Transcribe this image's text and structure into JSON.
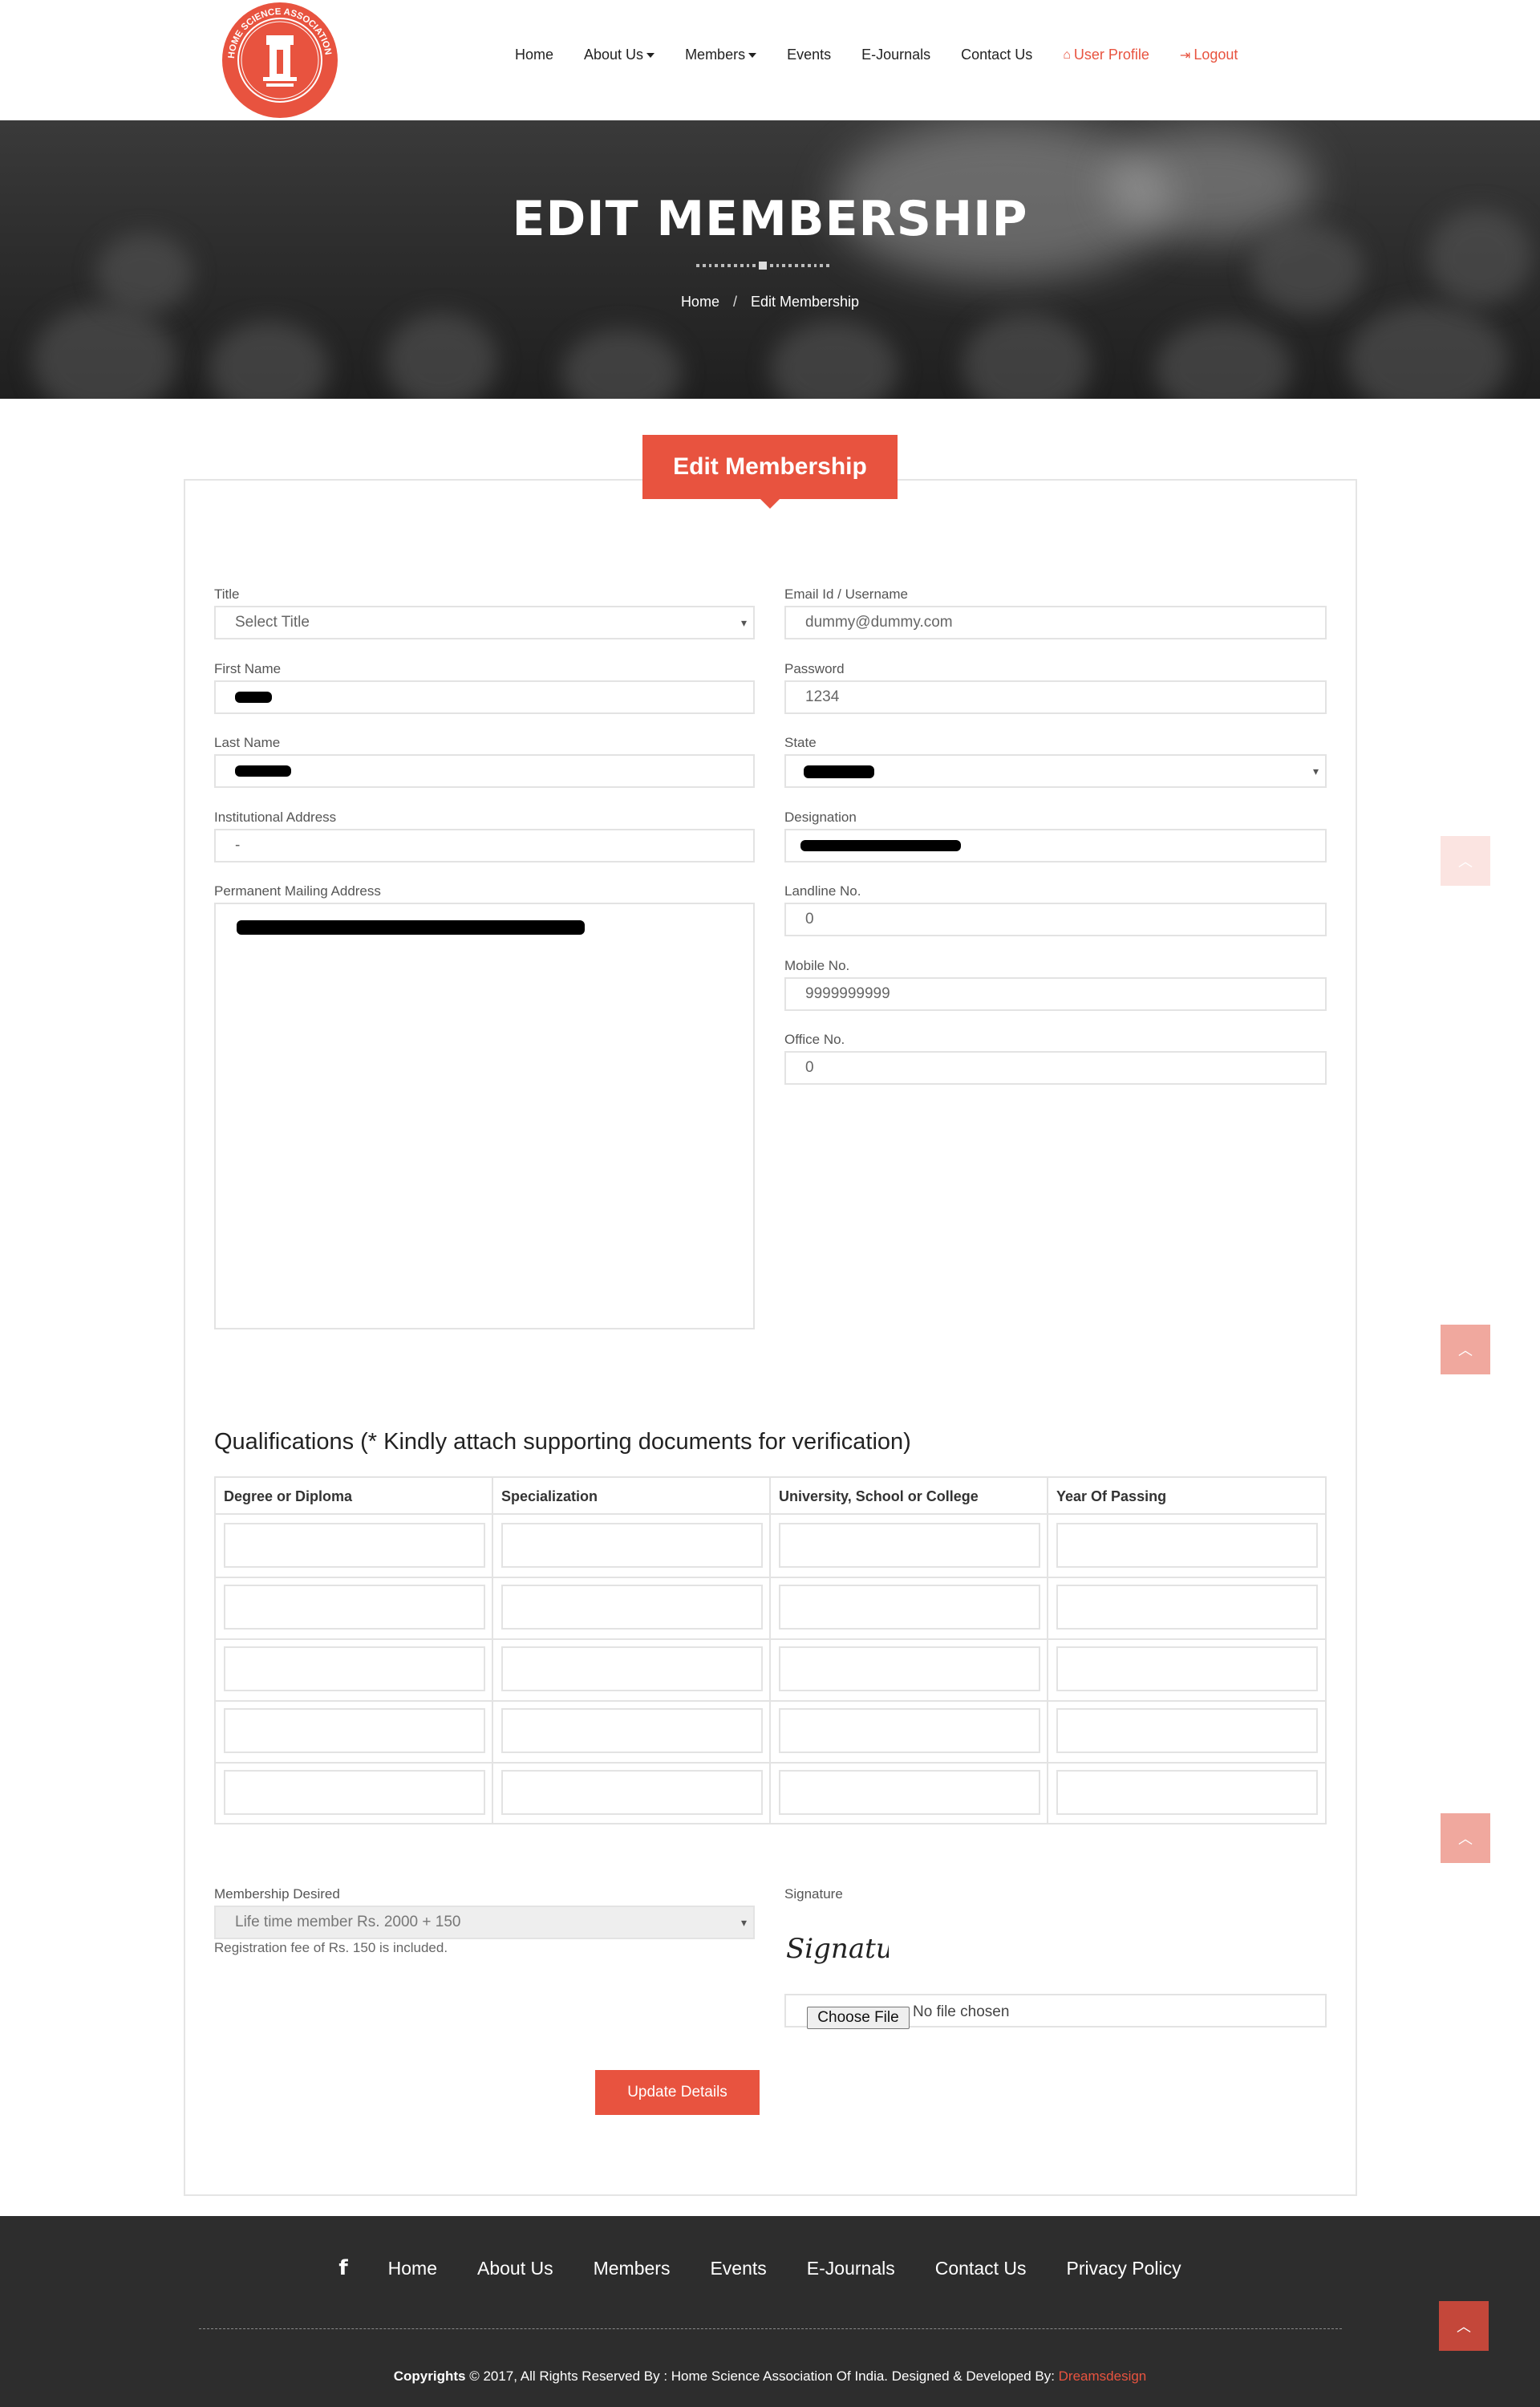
{
  "header": {
    "logo_text": "HOME SCIENCE ASSOCIATION OF INDIA",
    "nav": {
      "home": "Home",
      "about": "About Us",
      "members": "Members",
      "events": "Events",
      "ejournals": "E-Journals",
      "contact": "Contact Us",
      "user_profile": "User Profile",
      "logout": "Logout"
    }
  },
  "hero": {
    "title": "EDIT MEMBERSHIP",
    "breadcrumb_home": "Home",
    "breadcrumb_sep": "/",
    "breadcrumb_current": "Edit Membership"
  },
  "form": {
    "tab_title": "Edit Membership",
    "title": {
      "label": "Title",
      "value": "Select Title"
    },
    "first_name": {
      "label": "First Name"
    },
    "last_name": {
      "label": "Last Name"
    },
    "institutional_address": {
      "label": "Institutional Address",
      "value": "-"
    },
    "permanent_address": {
      "label": "Permanent Mailing Address"
    },
    "email": {
      "label": "Email Id / Username",
      "value": "dummy@dummy.com"
    },
    "password": {
      "label": "Password",
      "value": "1234"
    },
    "state": {
      "label": "State"
    },
    "designation": {
      "label": "Designation"
    },
    "landline": {
      "label": "Landline No.",
      "value": "0"
    },
    "mobile": {
      "label": "Mobile No.",
      "value": "9999999999"
    },
    "office": {
      "label": "Office No.",
      "value": "0"
    },
    "qualifications": {
      "title": "Qualifications (* Kindly attach supporting documents for verification)",
      "columns": [
        "Degree or Diploma",
        "Specialization",
        "University, School or College",
        "Year Of Passing"
      ]
    },
    "membership": {
      "label": "Membership Desired",
      "value": "Life time member Rs. 2000 + 150",
      "help": "Registration fee of Rs. 150 is included."
    },
    "signature": {
      "label": "Signature",
      "image_text": "Signature",
      "choose_file": "Choose File",
      "no_file": "No file chosen"
    },
    "submit": "Update Details"
  },
  "footer": {
    "facebook_icon": "f",
    "links": [
      "Home",
      "About Us",
      "Members",
      "Events",
      "E-Journals",
      "Contact Us",
      "Privacy Policy"
    ],
    "copyright_bold": "Copyrights",
    "copyright_text": " © 2017, All Rights Reserved By : Home Science Association Of India. Designed & Developed By: ",
    "developer": "Dreamsdesign"
  },
  "colors": {
    "accent": "#e8533f",
    "footer_bg": "#2d2d2d"
  },
  "icons": {
    "user_profile": "home-icon",
    "logout": "sign-out-icon",
    "scroll_top": "chevron-up-icon",
    "facebook": "facebook-icon"
  }
}
